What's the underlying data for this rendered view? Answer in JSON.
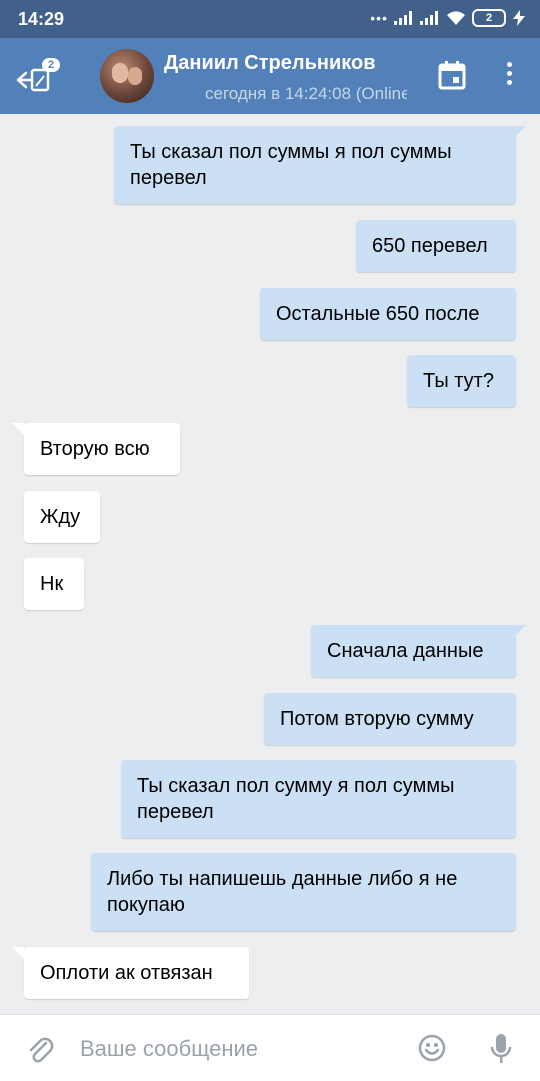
{
  "status_bar": {
    "time": "14:29",
    "battery": "2"
  },
  "header": {
    "unread_count": "2",
    "contact_name": "Даниил Стрельников",
    "contact_status": "сегодня в 14:24:08 (Online)"
  },
  "messages": [
    {
      "direction": "out",
      "text": "Ты сказал пол суммы я пол суммы перевел"
    },
    {
      "direction": "out",
      "text": "650 перевел"
    },
    {
      "direction": "out",
      "text": "Остальные 650 после"
    },
    {
      "direction": "out",
      "text": "Ты тут?"
    },
    {
      "direction": "in",
      "text": "Вторую всю"
    },
    {
      "direction": "in",
      "text": "Жду"
    },
    {
      "direction": "in",
      "text": "Нк"
    },
    {
      "direction": "out",
      "text": "Сначала данные"
    },
    {
      "direction": "out",
      "text": "Потом вторую сумму"
    },
    {
      "direction": "out",
      "text": "Ты сказал пол сумму я пол суммы перевел"
    },
    {
      "direction": "out",
      "text": "Либо ты напишешь данные либо я не покупаю"
    },
    {
      "direction": "in",
      "text": "Оплоти ак отвязан"
    }
  ],
  "composer": {
    "placeholder": "Ваше сообщение"
  },
  "colors": {
    "status_bar": "#41608a",
    "header": "#5181b8",
    "background": "#edeef0",
    "outgoing_bubble": "#cce0f5",
    "incoming_bubble": "#ffffff"
  },
  "icons": [
    "back-arrow-icon",
    "unread-badge",
    "calendar-icon",
    "more-icon",
    "attach-icon",
    "emoji-icon",
    "microphone-icon",
    "signal-icon",
    "wifi-icon",
    "battery-icon",
    "charging-icon"
  ]
}
